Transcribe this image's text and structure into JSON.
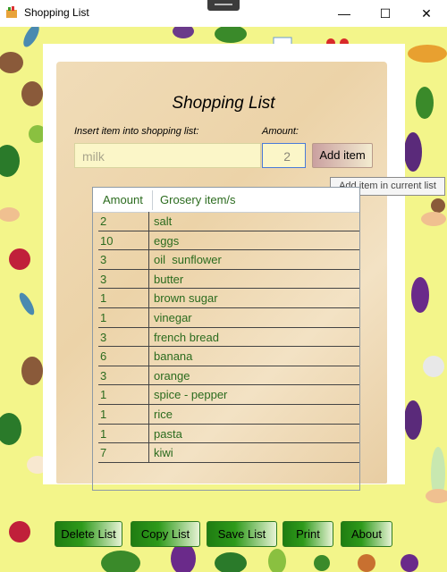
{
  "window": {
    "title": "Shopping List",
    "controls": {
      "minimize": "—",
      "maximize": "☐",
      "close": "✕"
    }
  },
  "form": {
    "heading": "Shopping List",
    "item_label": "Insert item into shopping list:",
    "amount_label": "Amount:",
    "item_value": "milk",
    "amount_value": "2",
    "add_button": "Add item",
    "add_tooltip": "Add item in current list"
  },
  "grid": {
    "columns": [
      "Amount",
      "Grosery item/s"
    ],
    "rows": [
      {
        "amount": "2",
        "item": "salt"
      },
      {
        "amount": "10",
        "item": "eggs"
      },
      {
        "amount": "3",
        "item": "oil  sunflower"
      },
      {
        "amount": "3",
        "item": "butter"
      },
      {
        "amount": "1",
        "item": "brown sugar"
      },
      {
        "amount": "1",
        "item": "vinegar"
      },
      {
        "amount": "3",
        "item": "french bread"
      },
      {
        "amount": "6",
        "item": "banana"
      },
      {
        "amount": "3",
        "item": "orange"
      },
      {
        "amount": "1",
        "item": "spice - pepper"
      },
      {
        "amount": "1",
        "item": "rice"
      },
      {
        "amount": "1",
        "item": "pasta"
      },
      {
        "amount": "7",
        "item": "kiwi"
      }
    ]
  },
  "actions": {
    "delete": "Delete List",
    "copy": "Copy List",
    "save": "Save List",
    "print": "Print",
    "about": "About"
  },
  "colors": {
    "background": "#f3f58a",
    "text_green": "#2b6b1e",
    "button_green": "#1f7d12"
  }
}
